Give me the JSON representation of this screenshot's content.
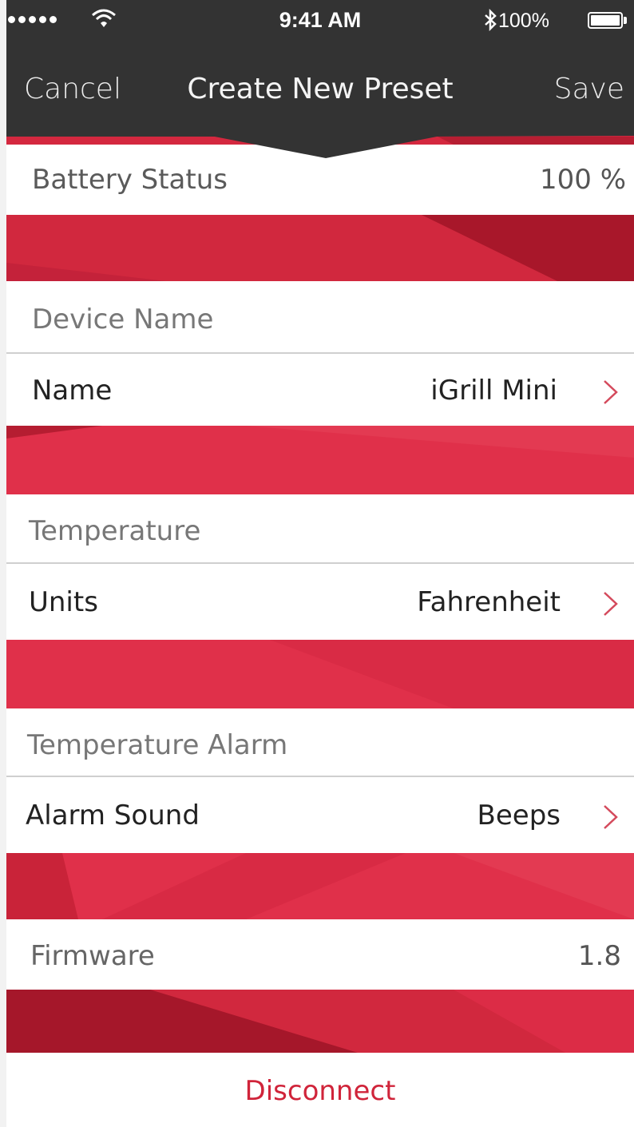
{
  "status_bar": {
    "signal_dots": 5,
    "time": "9:41 AM",
    "battery_percent": "100%",
    "icons": [
      "signal-dots-icon",
      "wifi-icon",
      "bluetooth-icon",
      "battery-icon"
    ]
  },
  "nav": {
    "cancel_label": "Cancel",
    "title": "Create New Preset",
    "save_label": "Save"
  },
  "battery": {
    "label": "Battery Status",
    "value": "100 %"
  },
  "device_name": {
    "header": "Device Name",
    "name_label": "Name",
    "name_value": "iGrill Mini"
  },
  "temperature": {
    "header": "Temperature",
    "units_label": "Units",
    "units_value": "Fahrenheit"
  },
  "alarm": {
    "header": "Temperature Alarm",
    "sound_label": "Alarm Sound",
    "sound_value": "Beeps"
  },
  "firmware": {
    "label": "Firmware",
    "value": "1.8"
  },
  "disconnect_label": "Disconnect",
  "colors": {
    "bar": "#333333",
    "accent_red": "#e0304a",
    "dark_red": "#b0182c",
    "disconnect_text": "#d0243a",
    "chevron": "#d44a5c"
  }
}
